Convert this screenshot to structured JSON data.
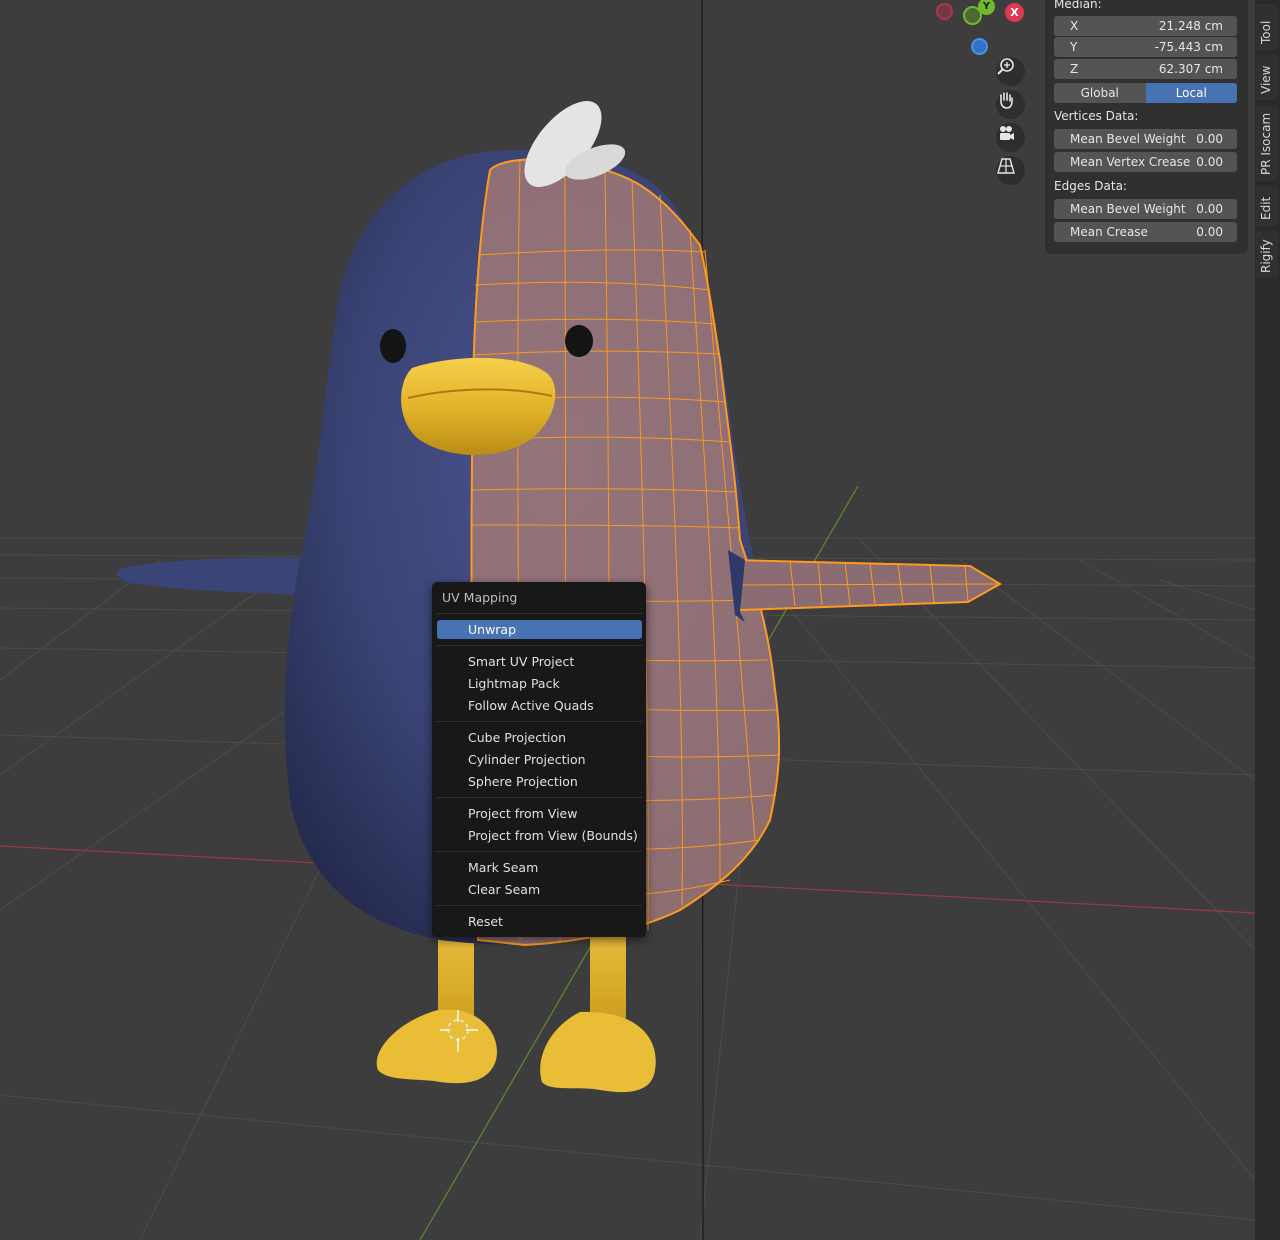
{
  "viewport": {
    "icons": [
      "zoom-icon",
      "hand-pan-icon",
      "camera-icon",
      "perspective-grid-icon"
    ]
  },
  "gizmo": {
    "x_label": "X",
    "y_label": "Y"
  },
  "transform_panel": {
    "median_label": "Median:",
    "x_label": "X",
    "x_value": "21.248 cm",
    "y_label": "Y",
    "y_value": "-75.443 cm",
    "z_label": "Z",
    "z_value": "62.307 cm",
    "global_label": "Global",
    "local_label": "Local",
    "vertices_heading": "Vertices Data:",
    "vertex_bevel_label": "Mean Bevel Weight",
    "vertex_bevel_value": "0.00",
    "vertex_crease_label": "Mean Vertex Crease",
    "vertex_crease_value": "0.00",
    "edges_heading": "Edges Data:",
    "edge_bevel_label": "Mean Bevel Weight",
    "edge_bevel_value": "0.00",
    "edge_crease_label": "Mean Crease",
    "edge_crease_value": "0.00"
  },
  "sidebar_tabs": [
    "Tool",
    "View",
    "PR Isocam",
    "Edit",
    "Rigify"
  ],
  "uv_menu": {
    "title": "UV Mapping",
    "items": [
      "Unwrap",
      "Smart UV Project",
      "Lightmap Pack",
      "Follow Active Quads",
      "Cube Projection",
      "Cylinder Projection",
      "Sphere Projection",
      "Project from View",
      "Project from View (Bounds)",
      "Mark Seam",
      "Clear Seam",
      "Reset"
    ]
  },
  "colors": {
    "viewport_bg": "#3d3d3d",
    "body_navy": "#3b4476",
    "beak_yellow": "#e1b72f",
    "wire_orange": "#ff9a1f",
    "accent_blue": "#4772b3"
  }
}
